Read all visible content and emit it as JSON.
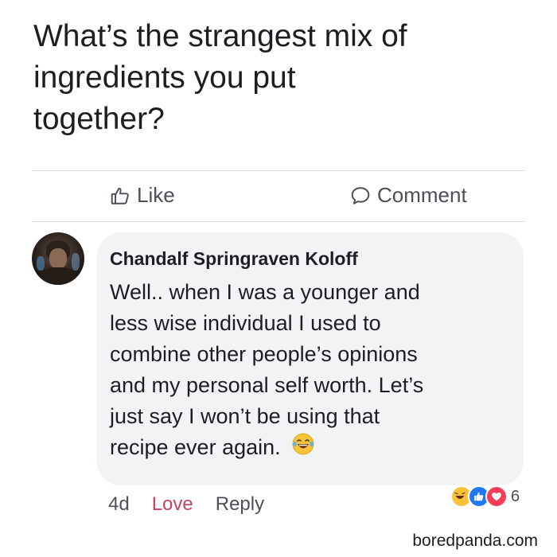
{
  "post": {
    "text_lines": [
      "What’s the strangest mix of",
      "ingredients you put",
      "together?"
    ]
  },
  "actions": {
    "like_label": "Like",
    "comment_label": "Comment"
  },
  "comment": {
    "author": "Chandalf Springraven Koloff",
    "text_lines": [
      "Well.. when I was a younger and",
      "less wise individual I used to",
      "combine other people’s opinions",
      "and my personal self worth. Let’s",
      "just say I won’t be using that",
      "recipe ever again."
    ],
    "inline_emoji": "laughing-tears-emoji",
    "time": "4d",
    "love_label": "Love",
    "reply_label": "Reply",
    "reactions": {
      "types": [
        "haha",
        "like",
        "love"
      ],
      "count": "6"
    }
  },
  "watermark": "boredpanda.com",
  "colors": {
    "text": "#1c1e21",
    "secondary": "#4b4f56",
    "love": "#c24662",
    "bubble": "#f2f3f5",
    "like_blue": "#2078f4",
    "love_red": "#f33e58",
    "haha_yellow": "#f7c33b"
  }
}
